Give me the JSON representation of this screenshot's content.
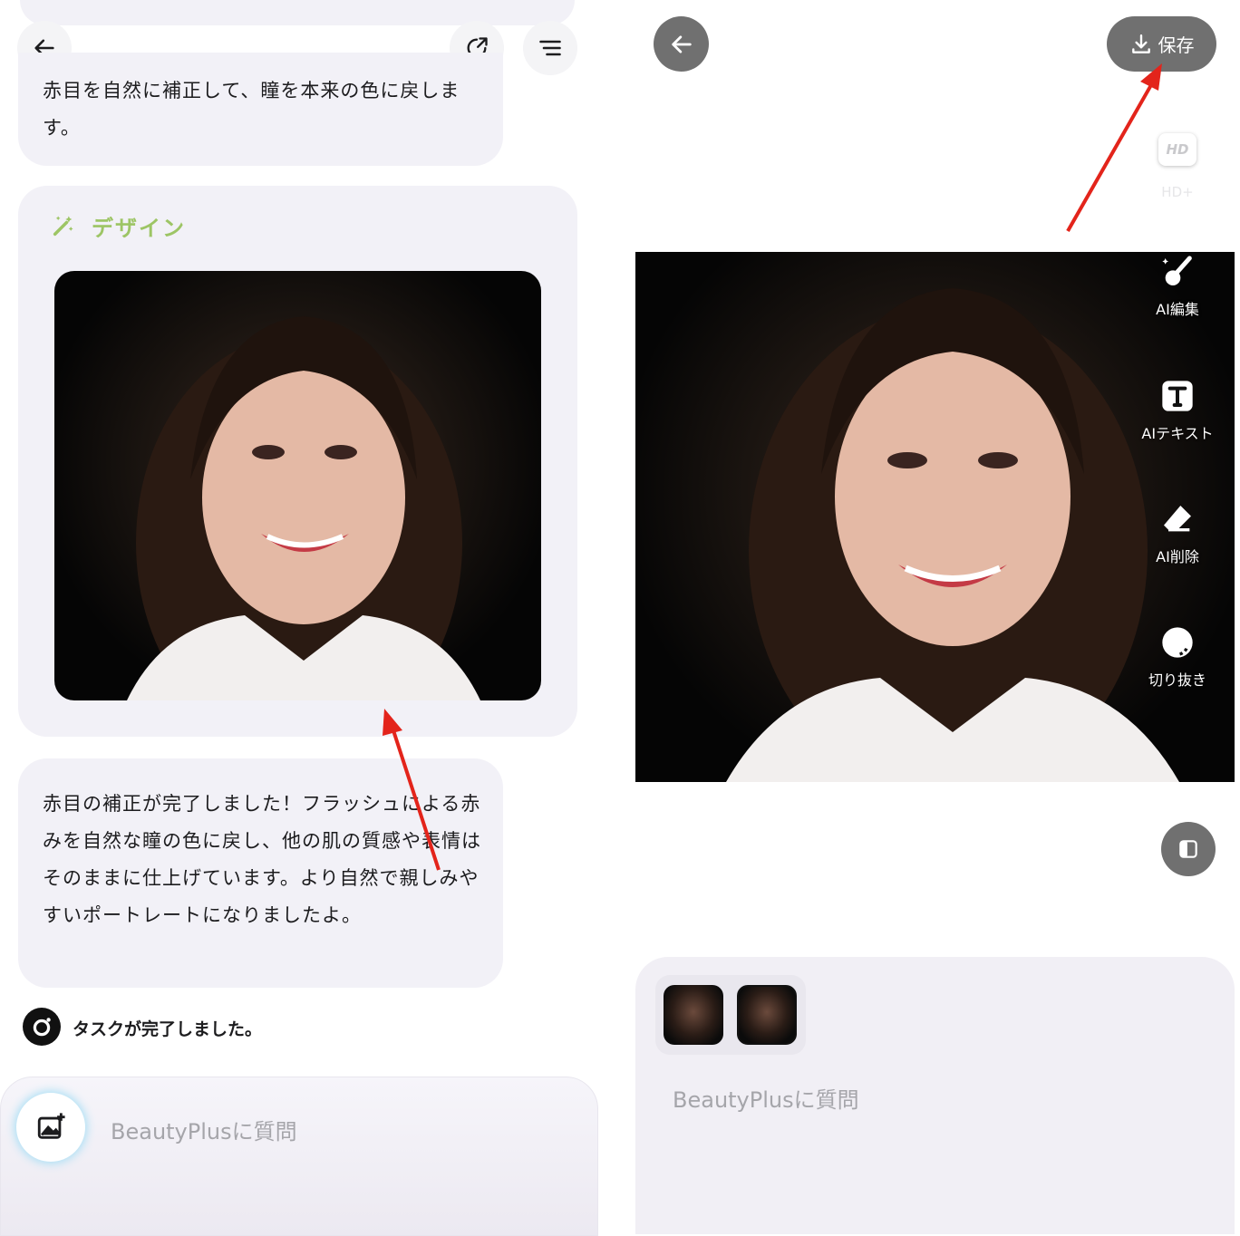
{
  "left": {
    "bubble_top": {
      "text": "赤目を自然に補正して、瞳を本来の色に戻します。"
    },
    "design_card": {
      "title": "デザイン",
      "image_alt": "smiling woman portrait"
    },
    "bubble_result": {
      "text": "赤目の補正が完了しました！フラッシュによる赤みを自然な瞳の色に戻し、他の肌の質感や表情はそのままに仕上げています。より自然で親しみやすいポートレートになりましたよ。"
    },
    "task_status": "タスクが完了しました。",
    "input": {
      "placeholder": "BeautyPlusに質問"
    }
  },
  "right": {
    "save_label": "保存",
    "hd": {
      "badge": "HD",
      "label": "HD+"
    },
    "tools": [
      {
        "label": "AI編集",
        "icon": "magic-brush-icon"
      },
      {
        "label": "AIテキスト",
        "icon": "text-icon"
      },
      {
        "label": "AI削除",
        "icon": "eraser-icon"
      },
      {
        "label": "切り抜き",
        "icon": "cutout-icon"
      }
    ],
    "input": {
      "placeholder": "BeautyPlusに質問"
    }
  },
  "colors": {
    "accent_green": "#9dc565",
    "bubble_bg": "#f2f1f7",
    "arrow_red": "#e3241b",
    "dark_button": "#707070"
  }
}
